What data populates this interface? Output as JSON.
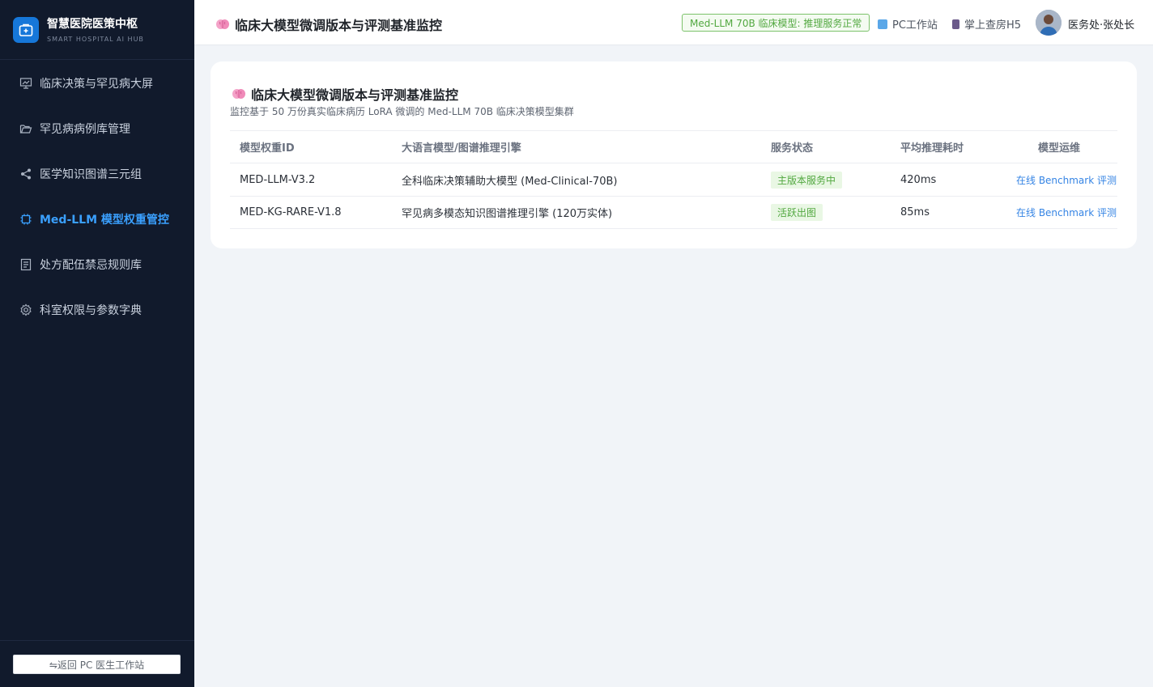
{
  "brand": {
    "title": "智慧医院医策中枢",
    "subtitle": "SMART HOSPITAL AI HUB",
    "logo_color": "#1677d9"
  },
  "sidebar": {
    "items": [
      {
        "label": "临床决策与罕见病大屏",
        "icon": "presentation-icon",
        "active": false
      },
      {
        "label": "罕见病病例库管理",
        "icon": "folder-icon",
        "active": false
      },
      {
        "label": "医学知识图谱三元组",
        "icon": "share-icon",
        "active": false
      },
      {
        "label": "Med-LLM 模型权重管控",
        "icon": "chip-icon",
        "active": true
      },
      {
        "label": "处方配伍禁忌规则库",
        "icon": "document-icon",
        "active": false
      },
      {
        "label": "科室权限与参数字典",
        "icon": "gear-icon",
        "active": false
      }
    ],
    "footer_button": "⇋返回 PC 医生工作站"
  },
  "header": {
    "title": "临床大模型微调版本与评测基准监控",
    "status_pill": "Med-LLM 70B 临床模型: 推理服务正常",
    "link_pc": "PC工作站",
    "link_mobile": "掌上查房H5",
    "user_name": "医务处·张处长"
  },
  "card": {
    "title": "临床大模型微调版本与评测基准监控",
    "subtitle": "监控基于 50 万份真实临床病历 LoRA 微调的 Med-LLM 70B 临床决策模型集群",
    "columns": [
      "模型权重ID",
      "大语言模型/图谱推理引擎",
      "服务状态",
      "平均推理耗时",
      "模型运维"
    ],
    "rows": [
      {
        "id": "MED-LLM-V3.2",
        "engine": "全科临床决策辅助大模型 (Med-Clinical-70B)",
        "status": "主版本服务中",
        "latency": "420ms",
        "action": "在线 Benchmark 评测"
      },
      {
        "id": "MED-KG-RARE-V1.8",
        "engine": "罕见病多模态知识图谱推理引擎 (120万实体)",
        "status": "活跃出图",
        "latency": "85ms",
        "action": "在线 Benchmark 评测"
      }
    ]
  },
  "colors": {
    "sidebar_bg": "#111a2c",
    "active": "#3aa0ff",
    "success": "#52a840",
    "link": "#3584e4"
  }
}
